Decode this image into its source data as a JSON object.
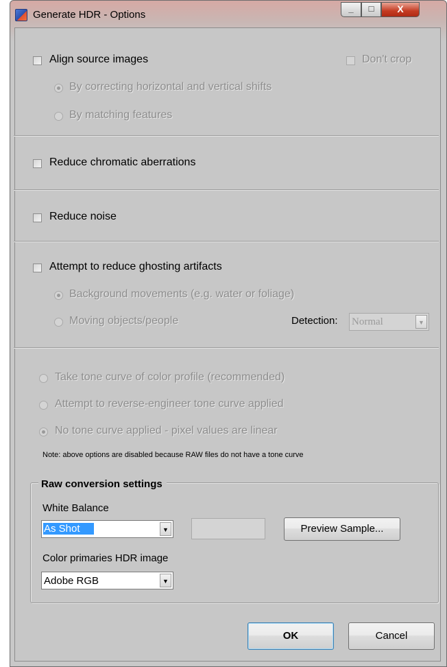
{
  "window": {
    "title": "Generate HDR - Options",
    "controls": {
      "minimize": "_",
      "maximize": "□",
      "close": "X"
    }
  },
  "alignment": {
    "checkbox_label": "Align source images",
    "dont_crop_label": "Don't crop",
    "options": [
      {
        "label": "By correcting horizontal and vertical shifts",
        "selected": true
      },
      {
        "label": "By matching features",
        "selected": false
      }
    ]
  },
  "chromatic": {
    "checkbox_label": "Reduce chromatic aberrations"
  },
  "noise": {
    "checkbox_label": "Reduce noise"
  },
  "ghosting": {
    "checkbox_label": "Attempt to reduce ghosting artifacts",
    "options": [
      {
        "label": "Background movements (e.g. water or foliage)",
        "selected": true
      },
      {
        "label": "Moving objects/people",
        "selected": false
      }
    ],
    "detection_label": "Detection:",
    "detection_value": "Normal"
  },
  "tone_curve": {
    "options": [
      {
        "label": "Take tone curve of color profile (recommended)",
        "selected": false
      },
      {
        "label": "Attempt to reverse-engineer tone curve applied",
        "selected": false
      },
      {
        "label": "No tone curve applied - pixel values are linear",
        "selected": true
      }
    ],
    "note": "Note: above options are disabled because RAW files do not have a tone curve"
  },
  "raw": {
    "group_title": "Raw conversion settings",
    "white_balance_label": "White Balance",
    "white_balance_value": "As Shot",
    "preview_button": "Preview Sample...",
    "color_primaries_label": "Color primaries HDR image",
    "color_primaries_value": "Adobe RGB"
  },
  "buttons": {
    "ok": "OK",
    "cancel": "Cancel"
  },
  "colors": {
    "dialog_background": "#c7c7c7",
    "disabled_text": "#8d8d8d",
    "selection_highlight": "#3399ff",
    "close_button": "#c43b22"
  }
}
